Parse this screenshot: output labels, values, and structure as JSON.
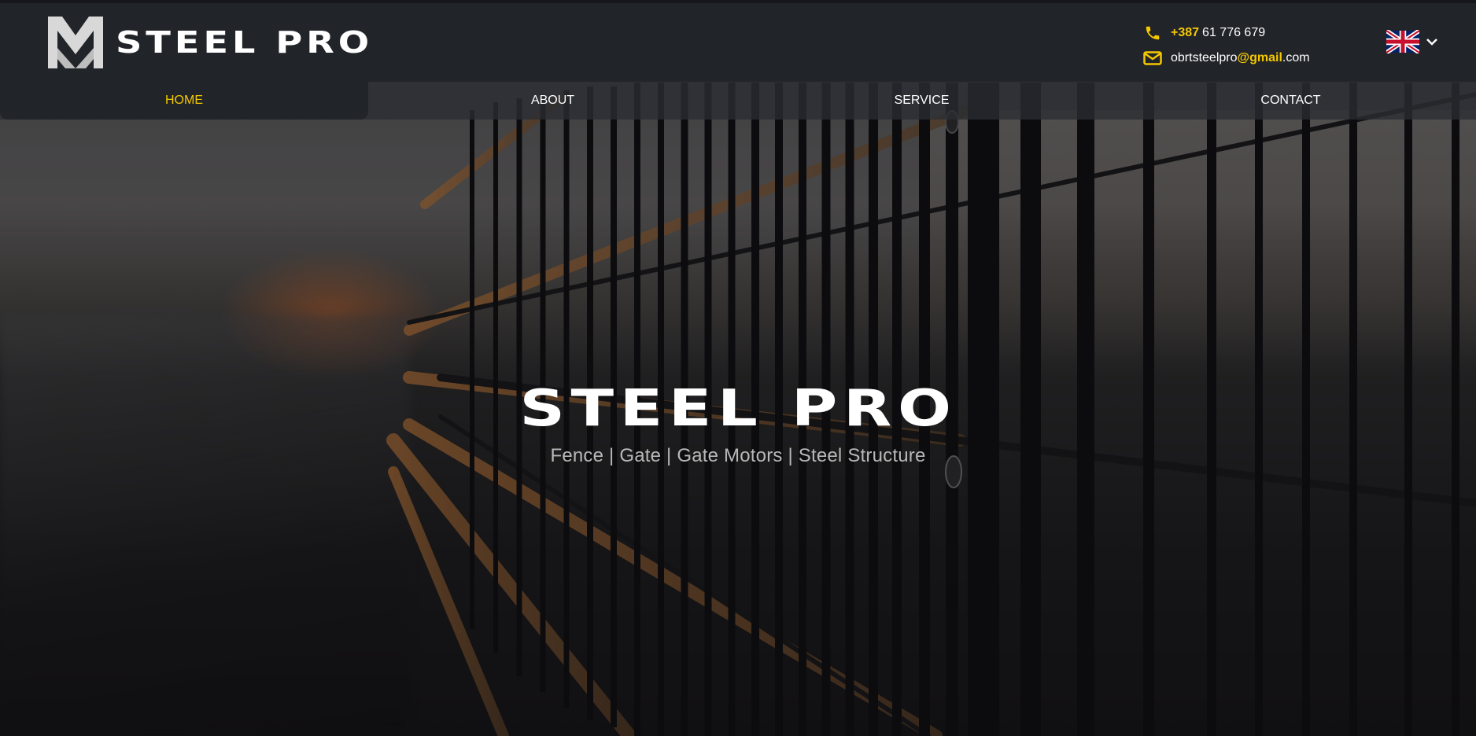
{
  "brand": {
    "name": "STEEL PRO",
    "logo_icon": "steel-pro-logo-icon"
  },
  "contact": {
    "phone_prefix": "+387",
    "phone_number": "61 776 679",
    "email_user": "obrtsteelpro",
    "email_domain": "@gmail",
    "email_tld": ".com",
    "phone_icon": "phone-icon",
    "email_icon": "envelope-icon"
  },
  "language": {
    "flag_icon": "uk-flag-icon",
    "toggle_icon": "chevron-down-icon"
  },
  "nav": {
    "items": [
      {
        "label": "HOME",
        "active": true
      },
      {
        "label": "ABOUT",
        "active": false
      },
      {
        "label": "SERVICE",
        "active": false
      },
      {
        "label": "CONTACT",
        "active": false
      }
    ]
  },
  "hero": {
    "title": "STEEL PRO",
    "subtitle": "Fence | Gate | Gate Motors | Steel Structure"
  },
  "colors": {
    "accent": "#f5c800",
    "header_bg": "#212429",
    "nav_bg": "#2a2d32",
    "text": "#ffffff"
  }
}
